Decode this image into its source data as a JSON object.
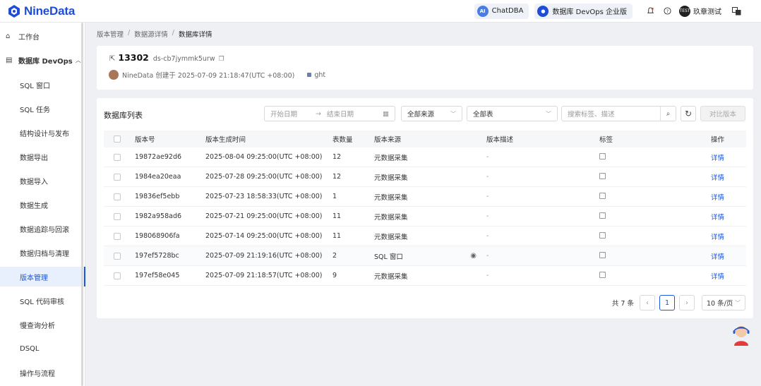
{
  "app": {
    "name": "NineData"
  },
  "topbar": {
    "chatdba_label": "ChatDBA",
    "chatdba_badge": "AI",
    "edition_label": "数据库 DevOps 企业版",
    "user_avatar_text": "TEST",
    "user_name": "玖章测试"
  },
  "sidebar": {
    "workbench": "工作台",
    "group_label": "数据库 DevOps",
    "items": [
      "SQL 窗口",
      "SQL 任务",
      "结构设计与发布",
      "数据导出",
      "数据导入",
      "数据生成",
      "数据追踪与回滚",
      "数据归档与清理",
      "版本管理",
      "SQL 代码审核",
      "慢查询分析",
      "DSQL",
      "操作与流程"
    ],
    "active_index": 8
  },
  "breadcrumb": [
    "版本管理",
    "数据源详情",
    "数据库详情"
  ],
  "header": {
    "id": "13302",
    "datasource": "ds-cb7jymmk5urw",
    "creator_line": "NineData 创建于 2025-07-09 21:18:47(UTC +08:00)",
    "tag": "ght"
  },
  "list": {
    "title": "数据库列表",
    "start_placeholder": "开始日期",
    "end_placeholder": "结束日期",
    "source_filter": "全部来源",
    "table_filter": "全部表",
    "search_placeholder": "搜索标签、描述",
    "compare_button": "对比版本",
    "columns": [
      "版本号",
      "版本生成时间",
      "表数量",
      "版本来源",
      "版本描述",
      "标签",
      "操作"
    ],
    "rows": [
      {
        "version": "19872ae92d6",
        "time": "2025-08-04 09:25:00(UTC +08:00)",
        "count": "12",
        "source": "元数据采集",
        "desc": "-",
        "action": "详情"
      },
      {
        "version": "1984ea20eaa",
        "time": "2025-07-28 09:25:00(UTC +08:00)",
        "count": "12",
        "source": "元数据采集",
        "desc": "-",
        "action": "详情"
      },
      {
        "version": "19836ef5ebb",
        "time": "2025-07-23 18:58:33(UTC +08:00)",
        "count": "1",
        "source": "元数据采集",
        "desc": "-",
        "action": "详情"
      },
      {
        "version": "1982a958ad6",
        "time": "2025-07-21 09:25:00(UTC +08:00)",
        "count": "11",
        "source": "元数据采集",
        "desc": "-",
        "action": "详情"
      },
      {
        "version": "198068906fa",
        "time": "2025-07-14 09:25:00(UTC +08:00)",
        "count": "11",
        "source": "元数据采集",
        "desc": "-",
        "action": "详情"
      },
      {
        "version": "197ef5728bc",
        "time": "2025-07-09 21:19:16(UTC +08:00)",
        "count": "2",
        "source": "SQL 窗口",
        "desc": "-",
        "action": "详情"
      },
      {
        "version": "197ef58e045",
        "time": "2025-07-09 21:18:57(UTC +08:00)",
        "count": "9",
        "source": "元数据采集",
        "desc": "-",
        "action": "详情"
      }
    ]
  },
  "pagination": {
    "total": "共 7 条",
    "current_page": "1",
    "page_size": "10 条/页"
  },
  "colors": {
    "brand": "#1e4dd8",
    "link": "#1a56db"
  }
}
